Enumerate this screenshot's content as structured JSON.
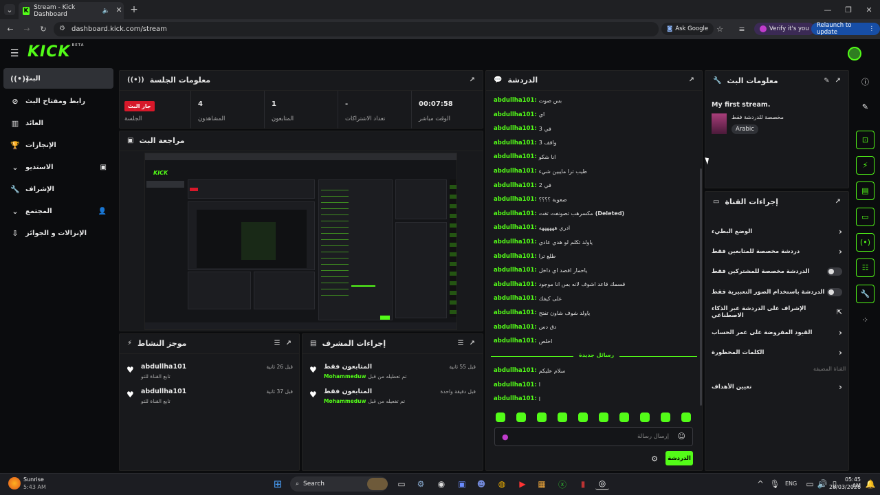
{
  "browser": {
    "tab_title": "Stream - Kick Dashboard",
    "url": "dashboard.kick.com/stream",
    "ask_google": "Ask Google",
    "verify": "Verify it's you",
    "relaunch": "Relaunch to update"
  },
  "kick": {
    "logo": "KICK",
    "beta": "BETA"
  },
  "sidebar": {
    "items": [
      {
        "label": "البث",
        "icon": "broadcast-icon"
      },
      {
        "label": "رابط ومفتاح البث",
        "icon": "link-icon"
      },
      {
        "label": "العائد",
        "icon": "chart-icon"
      },
      {
        "label": "الإنجازات",
        "icon": "trophy-icon"
      },
      {
        "label": "الاستديو",
        "icon": "studio-icon"
      },
      {
        "label": "الإشراف",
        "icon": "wrench-icon"
      },
      {
        "label": "المجتمع",
        "icon": "community-icon"
      },
      {
        "label": "الإنزالات و الجوائز",
        "icon": "drops-icon"
      }
    ]
  },
  "session": {
    "title": "معلومات الجلسة",
    "live_badge": "جار البث",
    "session_label": "الجلسة",
    "viewers_value": "4",
    "viewers_label": "المشاهدون",
    "followers_value": "1",
    "followers_label": "المتابعون",
    "subs_value": "-",
    "subs_label": "تعداد الاشتراكات",
    "live_time_value": "00:07:58",
    "live_time_label": "الوقت مباشر"
  },
  "preview": {
    "title": "مراجعة البث"
  },
  "activity": {
    "title": "موجز النشاط",
    "items": [
      {
        "name": "abdullha101",
        "sub": "تابع القناة للتو",
        "time": "قبل 26 ثانية"
      },
      {
        "name": "abdullha101",
        "sub": "تابع القناة للتو",
        "time": "قبل 37 ثانية"
      }
    ]
  },
  "modactions": {
    "title": "إجراءات المشرف",
    "items": [
      {
        "name": "المتابعون فقط",
        "sub": "تم تعطيله من قبل",
        "user": "Mohammeduw",
        "time": "قبل 55 ثانية"
      },
      {
        "name": "المتابعون فقط",
        "sub": "تم تفعيله من قبل",
        "user": "Mohammeduw",
        "time": "قبل دقيقة واحدة"
      }
    ]
  },
  "chat": {
    "title": "الدردشة",
    "messages": [
      {
        "user": "abdullha101:",
        "text": "بس صوت"
      },
      {
        "user": "abdullha101:",
        "text": "اي"
      },
      {
        "user": "abdullha101:",
        "text": "في 3"
      },
      {
        "user": "abdullha101:",
        "text": "واقف 3"
      },
      {
        "user": "abdullha101:",
        "text": "انا شكو"
      },
      {
        "user": "abdullha101:",
        "text": "طيب ترا مايبين شيء"
      },
      {
        "user": "abdullha101:",
        "text": "في 2"
      },
      {
        "user": "abdullha101:",
        "text": "صعوبة ؟؟؟؟"
      },
      {
        "user": "abdullha101:",
        "text": "مكسرهب تصونفت تقت",
        "deleted": "(Deleted)"
      },
      {
        "user": "abdullha101:",
        "text": "ادري ههههههه"
      },
      {
        "user": "abdullha101:",
        "text": "ياولد تكلم لو هدي عادي"
      },
      {
        "user": "abdullha101:",
        "text": "طلع ترا"
      },
      {
        "user": "abdullha101:",
        "text": "ياحمار اقصد اي داخل"
      },
      {
        "user": "abdullha101:",
        "text": "قسمك قاعد اشوف لانه بس انا موجود"
      },
      {
        "user": "abdullha101:",
        "text": "على كيفك"
      },
      {
        "user": "abdullha101:",
        "text": "ياولد شوف شاون تفتح"
      },
      {
        "user": "abdullha101:",
        "text": "دق دس"
      },
      {
        "user": "abdullha101:",
        "text": "اخلص"
      }
    ],
    "new_messages": "رسائل جديدة",
    "new": [
      {
        "user": "abdullha101:",
        "text": "سلام عليكم"
      },
      {
        "user": "abdullha101:",
        "text": "ا"
      },
      {
        "user": "abdullha101:",
        "text": "ا"
      }
    ],
    "placeholder": "إرسال رسالة",
    "send": "الدردشة"
  },
  "streaminfo": {
    "title": "معلومات البث",
    "stream_title": "My first stream.",
    "category": "مخصصة للدردشة فقط",
    "language": "Arabic"
  },
  "channelactions": {
    "title": "إجراءات القناة",
    "items": [
      {
        "label": "الوضع البطيء",
        "kind": "arrow"
      },
      {
        "label": "دردشة مخصصة للمتابعين فقط",
        "kind": "arrow"
      },
      {
        "label": "الدردشة مخصصة للمشتركين فقط",
        "kind": "toggle"
      },
      {
        "label": "الدردشة باستخدام الصور التعبيرية فقط",
        "kind": "toggle"
      },
      {
        "label": "الإشراف على الدردشة عبر الذكاء الاصطناعي",
        "kind": "link"
      },
      {
        "label": "القيود المفروضة على عمر الحساب",
        "kind": "arrow"
      },
      {
        "label": "الكلمات المحظورة",
        "kind": "arrow"
      }
    ],
    "host_label": "القناة المضيفة",
    "goals": "تعيين الأهداف"
  },
  "taskbar": {
    "weather": "Sunrise",
    "weather_time": "5:43 AM",
    "search": "Search",
    "lang": "ENG",
    "clock": "05:45 AM",
    "date": "28/03/2026"
  },
  "colors": {
    "accent": "#53fc18",
    "live": "#d7182a"
  }
}
